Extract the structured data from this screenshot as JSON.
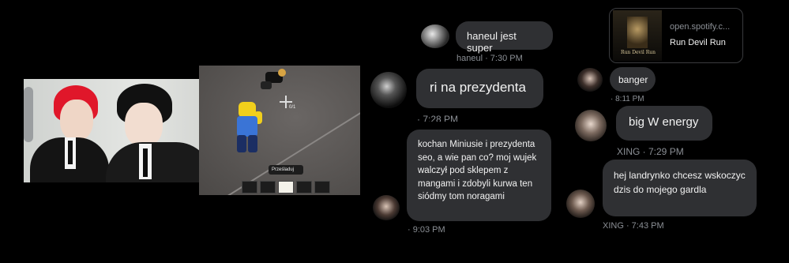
{
  "game": {
    "pursue_label": "Prześladuj",
    "counter": "0/1"
  },
  "chat_left": {
    "msg1": {
      "text": "haneul jest super",
      "meta": "haneul · 7:30 PM"
    },
    "msg2": {
      "text": "ri na prezydenta",
      "meta": "· 7:28 PM"
    },
    "msg3": {
      "text": "kochan Miniusie i prezydenta seo, a wie pan co? moj wujek walczył pod sklepem z mangami i zdobyli kurwa ten siódmy tom noragami",
      "meta": "· 9:03 PM"
    }
  },
  "chat_right": {
    "link": {
      "domain": "open.spotify.c...",
      "title": "Run Devil Run",
      "album_art_text": "Run Devil Run"
    },
    "msg1": {
      "text": "banger",
      "meta": "· 8:11 PM"
    },
    "msg2": {
      "text": "big W energy",
      "meta": "XING · 7:29 PM"
    },
    "msg3": {
      "text": "hej landrynko chcesz wskoczyc dzis do mojego gardla",
      "meta": "XING · 7:43 PM"
    }
  },
  "colors": {
    "background": "#000000",
    "bubble": "#2f3033",
    "meta_text": "#8b8f95"
  }
}
